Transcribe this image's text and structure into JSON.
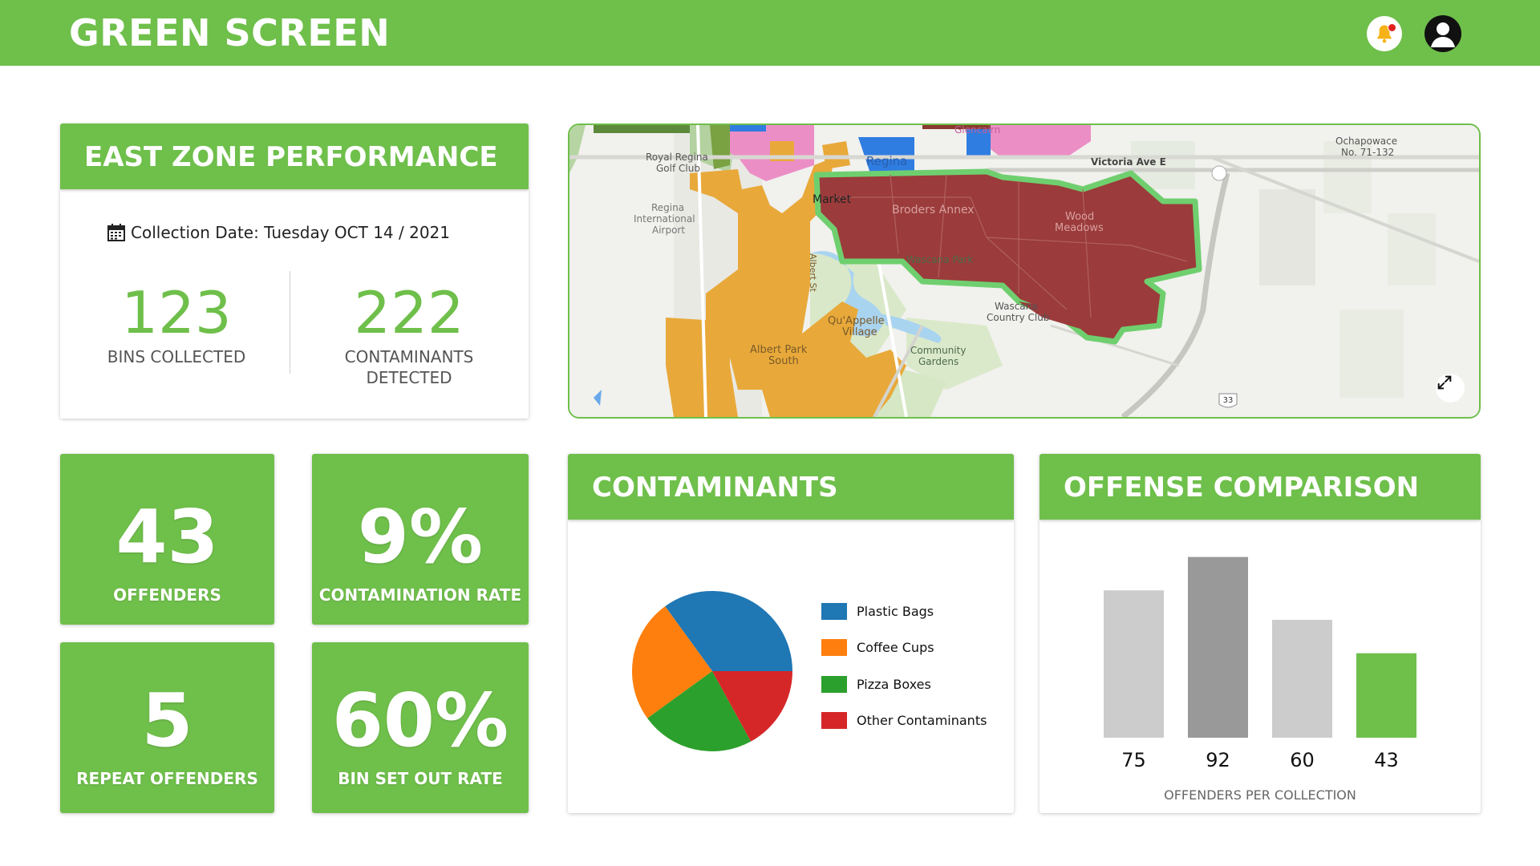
{
  "app": {
    "title": "GREEN SCREEN"
  },
  "header": {
    "bell_icon": "bell-icon",
    "user_icon": "user-avatar-icon",
    "notification_color": "#e0221f"
  },
  "colors": {
    "brand": "#6fbf4b",
    "map_zone_fill": "#9b3b3b",
    "map_zone_orange": "#e8a93a",
    "map_zone_pink": "#ec8ec6",
    "map_zone_blue": "#2f7de1"
  },
  "east_zone": {
    "title": "EAST ZONE PERFORMANCE",
    "date_icon": "calendar-icon",
    "date_text": "Collection Date: Tuesday OCT 14 / 2021",
    "bins_collected": {
      "value": "123",
      "label": "BINS COLLECTED"
    },
    "contaminants": {
      "value": "222",
      "label1": "CONTAMINANTS",
      "label2": "DETECTED"
    }
  },
  "map": {
    "labels": [
      "Glencairn",
      "Ochapowace",
      "No. 71-132",
      "Royal Regina",
      "Golf Club",
      "Regina",
      "Victoria Ave E",
      "Regina",
      "International",
      "Airport",
      "Market",
      "Broders Annex",
      "Wood",
      "Meadows",
      "Wascana Park",
      "Wascana",
      "Country Club",
      "Qu'Appelle",
      "Village",
      "Albert Park",
      "South",
      "Community",
      "Gardens",
      "Albert St",
      "33"
    ],
    "expand_icon": "expand-icon"
  },
  "tiles": [
    {
      "value": "43",
      "label": "OFFENDERS"
    },
    {
      "value": "9%",
      "label": "CONTAMINATION RATE"
    },
    {
      "value": "5",
      "label": "REPEAT OFFENDERS"
    },
    {
      "value": "60%",
      "label": "BIN SET OUT RATE"
    }
  ],
  "contaminants_panel": {
    "title": "CONTAMINANTS"
  },
  "offense_panel": {
    "title": "OFFENSE COMPARISON"
  },
  "chart_data": [
    {
      "type": "pie",
      "categories": [
        "Plastic Bags",
        "Coffee Cups",
        "Pizza Boxes",
        "Other Contaminants"
      ],
      "values": [
        35,
        25,
        23,
        17
      ],
      "colors": [
        "#1f77b4",
        "#ff7f0e",
        "#2ca02c",
        "#d62728"
      ],
      "legend": "right"
    },
    {
      "type": "bar",
      "categories": [
        "75",
        "92",
        "60",
        "43"
      ],
      "values": [
        75,
        92,
        60,
        43
      ],
      "colors": [
        "#cccccc",
        "#999999",
        "#cccccc",
        "#6fbf4b"
      ],
      "xlabel": "OFFENDERS PER COLLECTION",
      "ylim": [
        0,
        100
      ]
    }
  ]
}
